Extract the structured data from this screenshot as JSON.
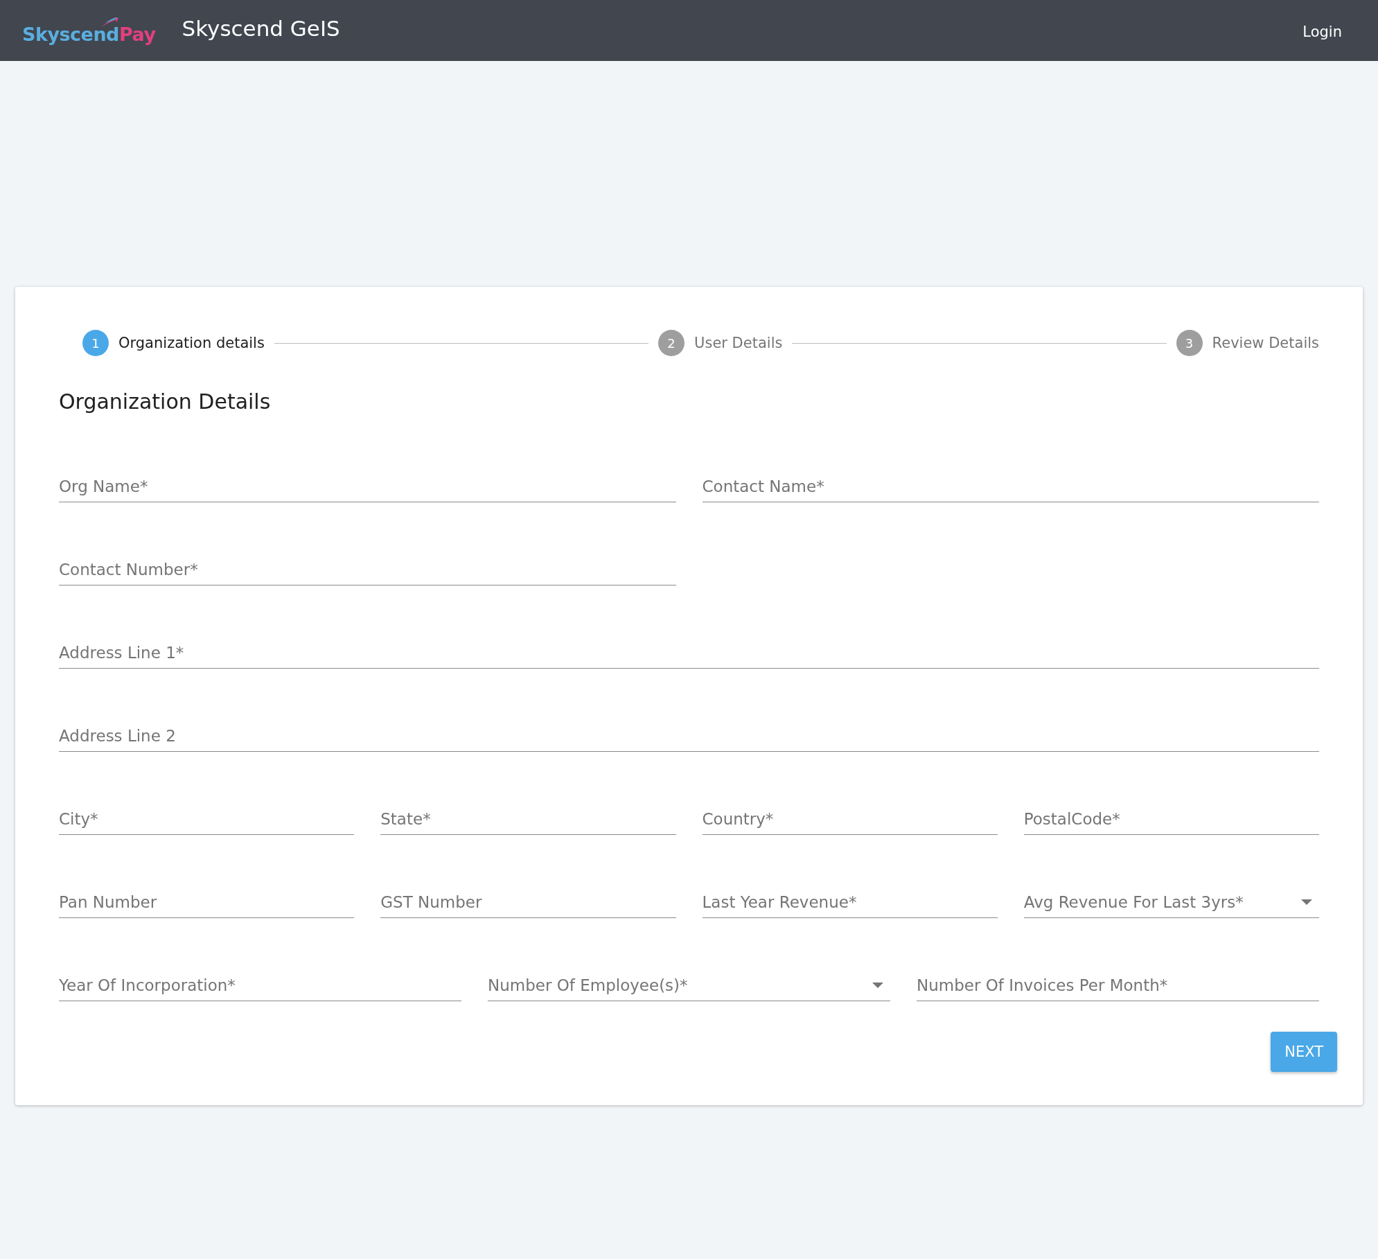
{
  "header": {
    "logo": {
      "primary": "Skyscend",
      "secondary": "Pay"
    },
    "title": "Skyscend GeIS",
    "login": "Login"
  },
  "stepper": [
    {
      "number": "1",
      "label": "Organization details",
      "selected": true
    },
    {
      "number": "2",
      "label": "User Details",
      "selected": false
    },
    {
      "number": "3",
      "label": "Review Details",
      "selected": false
    }
  ],
  "form": {
    "heading": "Organization Details",
    "rows": [
      {
        "kind": "grid",
        "fields": [
          {
            "kind": "text",
            "placeholder": "Org Name*"
          },
          {
            "kind": "text",
            "placeholder": "Contact Name*"
          }
        ]
      },
      {
        "kind": "half",
        "fields": [
          {
            "kind": "text",
            "placeholder": "Contact Number*"
          }
        ]
      },
      {
        "kind": "grid",
        "fields": [
          {
            "kind": "text",
            "placeholder": "Address Line 1*"
          }
        ]
      },
      {
        "kind": "grid",
        "fields": [
          {
            "kind": "text",
            "placeholder": "Address Line 2"
          }
        ]
      },
      {
        "kind": "grid",
        "fields": [
          {
            "kind": "text",
            "placeholder": "City*"
          },
          {
            "kind": "text",
            "placeholder": "State*"
          },
          {
            "kind": "text",
            "placeholder": "Country*"
          },
          {
            "kind": "text",
            "placeholder": "PostalCode*"
          }
        ]
      },
      {
        "kind": "grid",
        "fields": [
          {
            "kind": "text",
            "placeholder": "Pan Number"
          },
          {
            "kind": "text",
            "placeholder": "GST Number"
          },
          {
            "kind": "text",
            "placeholder": "Last Year Revenue*"
          },
          {
            "kind": "select",
            "placeholder": "Avg Revenue For Last 3yrs*"
          }
        ]
      },
      {
        "kind": "grid",
        "fields": [
          {
            "kind": "text",
            "placeholder": "Year Of Incorporation*"
          },
          {
            "kind": "select",
            "placeholder": "Number Of Employee(s)*"
          },
          {
            "kind": "text",
            "placeholder": "Number Of Invoices Per Month*"
          }
        ]
      }
    ],
    "next_button": "NEXT"
  }
}
